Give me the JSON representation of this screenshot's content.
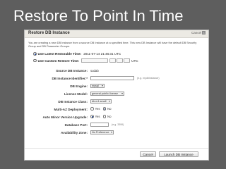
{
  "slide": {
    "title": "Restore To Point In Time"
  },
  "dialog": {
    "title": "Restore DB Instance",
    "cancel_label": "Cancel",
    "close_glyph": "×",
    "description": "You are creating a new DB Instance from a source DB Instance at a specified time. This new DB Instance will have the default DB Security Group and DB Parameter Groups.",
    "restore_options": [
      {
        "label": "Use Latest Restorable Time:",
        "value": "2011-07-14 21:46:31 UTC",
        "selected": true
      },
      {
        "label": "Use Custom Restore Time:",
        "value": "UTC",
        "selected": false
      }
    ],
    "fields": {
      "source_label": "Source DB Instance:",
      "source_value": "sudab",
      "identifier_label": "DB Instance Identifier:*",
      "identifier_value": "",
      "identifier_hint": "(e.g. mydbinstance)",
      "engine_label": "DB Engine:",
      "engine_value": "mysql",
      "license_label": "License Model:",
      "license_value": "general-public-license",
      "class_label": "DB Instance Class:",
      "class_value": "db.m1.small",
      "multiaz_label": "Multi-AZ Deployment:",
      "multiaz_yes": "Yes",
      "multiaz_no": "No",
      "autominor_label": "Auto Minor Version Upgrade:",
      "autominor_yes": "Yes",
      "autominor_no": "No",
      "port_label": "Database Port:",
      "port_value": "",
      "port_hint": "(e.g. 3306)",
      "az_label": "Availability Zone:",
      "az_value": "No Preference"
    },
    "buttons": {
      "cancel": "Cancel",
      "launch": "Launch DB Instance"
    }
  }
}
